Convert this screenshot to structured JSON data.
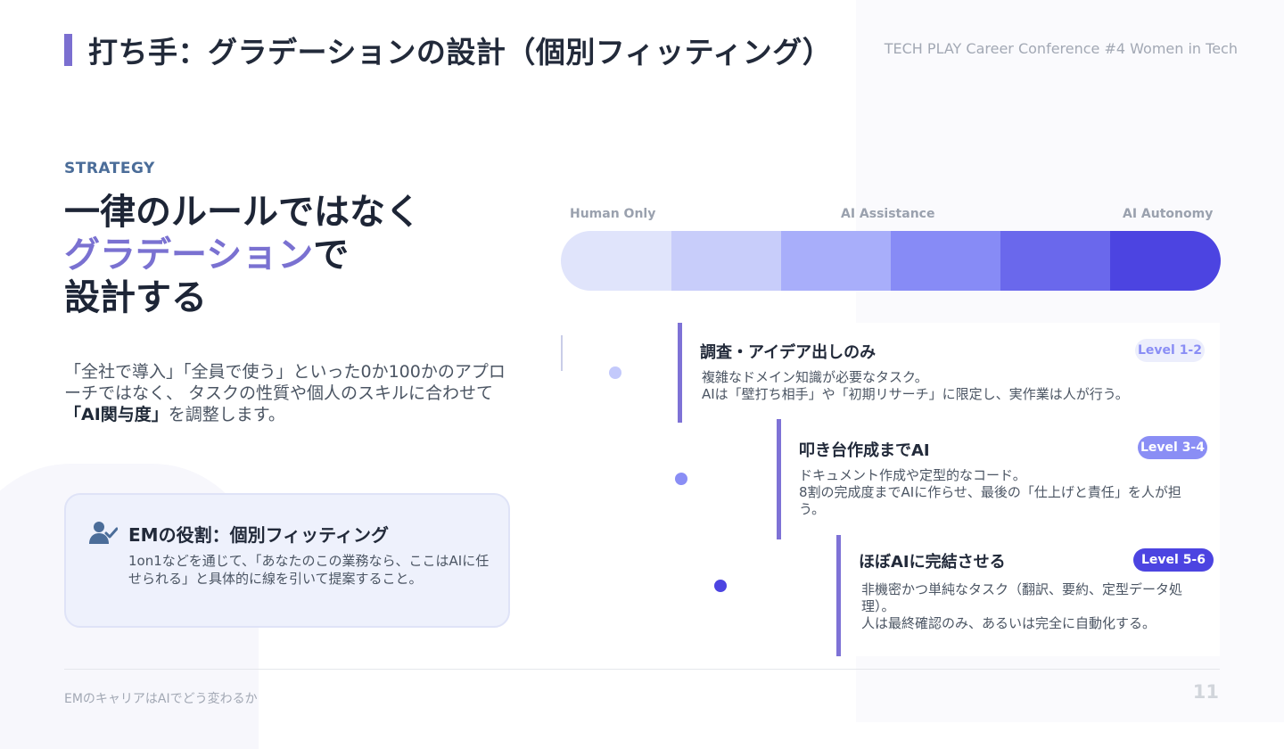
{
  "header": {
    "title": "打ち手：グラデーションの設計（個別フィッティング）",
    "conference": "TECH PLAY Career Conference #4 Women in Tech"
  },
  "left": {
    "eyebrow": "STRATEGY",
    "headline_line1": " 一律のルールではなく",
    "headline_grad": "グラデーション",
    "headline_line2_suffix": "で",
    "headline_line3": " 設計する",
    "intro_pre": "「全社で導入」「全員で使う」といった0か100かのアプローチではなく、 タスクの性質や個人のスキルに合わせて",
    "intro_bold": "「AI関与度」",
    "intro_post": "を調整します。",
    "role_card": {
      "icon": "user-check-icon",
      "title": "EMの役割：個別フィッティング",
      "text": "1on1などを通じて、「あなたのこの業務なら、ここはAIに任せられる」と具体的に線を引いて提案すること。"
    }
  },
  "scale": {
    "labels": [
      "Human Only",
      "AI Assistance",
      "AI Autonomy"
    ],
    "colors": [
      "#e0e4fb",
      "#c8cdfa",
      "#a8aefa",
      "#878bf6",
      "#6a68ec",
      "#4c44e1"
    ]
  },
  "levels": [
    {
      "title": "調査・アイデア出しのみ",
      "badge": "Level 1-2",
      "line1": "複雑なドメイン知識が必要なタスク。",
      "line2": "AIは「壁打ち相手」や「初期リサーチ」に限定し、実作業は人が行う。"
    },
    {
      "title": "叩き台作成までAI",
      "badge": "Level 3-4",
      "line1": "ドキュメント作成や定型的なコード。",
      "line2": "8割の完成度までAIに作らせ、最後の「仕上げと責任」を人が担う。"
    },
    {
      "title": "ほぼAIに完結させる",
      "badge": "Level 5-6",
      "line1": "非機密かつ単純なタスク（翻訳、要約、定型データ処理）。",
      "line2": "人は最終確認のみ、あるいは完全に自動化する。"
    }
  ],
  "footer": {
    "left": "EMのキャリアはAIでどう変わるか",
    "page": "11"
  }
}
